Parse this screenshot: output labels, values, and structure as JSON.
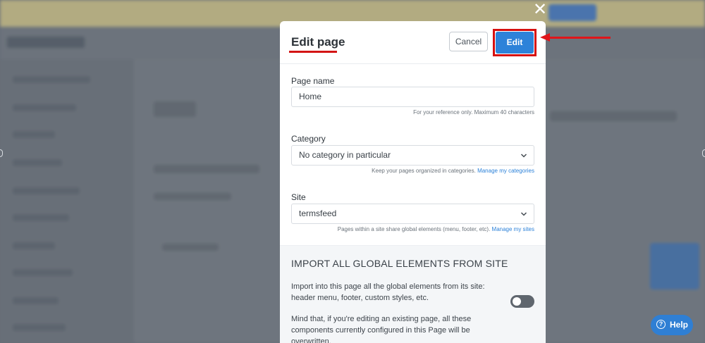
{
  "modal": {
    "title": "Edit page",
    "cancel_label": "Cancel",
    "edit_label": "Edit",
    "page_name": {
      "label": "Page name",
      "value": "Home",
      "help": "For your reference only. Maximum 40 characters"
    },
    "category": {
      "label": "Category",
      "selected": "No category in particular",
      "help": "Keep your pages organized in categories.",
      "link": "Manage my categories"
    },
    "site": {
      "label": "Site",
      "selected": "termsfeed",
      "help": "Pages within a site share global elements (menu, footer, etc).",
      "link": "Manage my sites"
    },
    "import_section": {
      "title": "IMPORT ALL GLOBAL ELEMENTS FROM SITE",
      "description": "Import into this page all the global elements from its site: header menu, footer, custom styles, etc.",
      "warning": "Mind that, if you're editing an existing page, all these components currently configured in this Page will be overwritten.",
      "toggle_on": false
    }
  },
  "help_button": {
    "label": "Help"
  },
  "icons": {
    "close": "close-icon",
    "chevron": "chevron-down-icon",
    "help": "question-circle-icon",
    "annotation_arrow": "red-arrow-icon"
  },
  "colors": {
    "accent": "#2d82d9",
    "annotation": "#d60f0f",
    "toggle_off": "#5f666e"
  }
}
